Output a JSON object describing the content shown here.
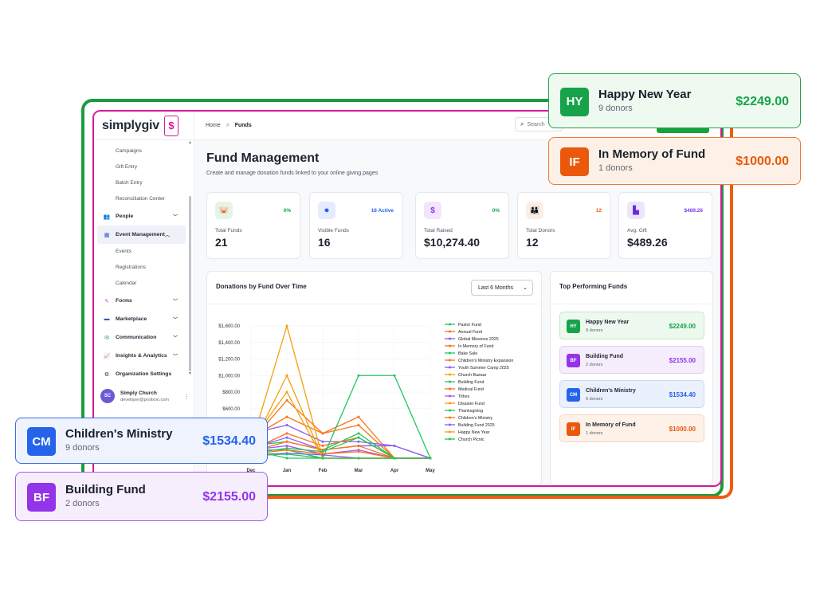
{
  "app": {
    "logo_text": "simplygiv",
    "logo_glyph": "$",
    "breadcrumb": {
      "home": "Home",
      "separator": ">",
      "current": "Funds"
    },
    "search_placeholder": "Search"
  },
  "sidebar": {
    "items": [
      {
        "label": "Campaigns",
        "kind": "sub"
      },
      {
        "label": "Gift Entry",
        "kind": "sub"
      },
      {
        "label": "Batch Entry",
        "kind": "sub"
      },
      {
        "label": "Reconciliation Center",
        "kind": "sub"
      },
      {
        "label": "People",
        "kind": "item",
        "icon": "people-icon",
        "chevron": "down"
      },
      {
        "label": "Event Management",
        "kind": "item",
        "icon": "calendar-icon",
        "chevron": "up",
        "active": true
      },
      {
        "label": "Events",
        "kind": "sub"
      },
      {
        "label": "Registrations",
        "kind": "sub"
      },
      {
        "label": "Calendar",
        "kind": "sub"
      },
      {
        "label": "Forms",
        "kind": "item",
        "icon": "forms-icon",
        "chevron": "down"
      },
      {
        "label": "Marketplace",
        "kind": "item",
        "icon": "store-icon",
        "chevron": "down"
      },
      {
        "label": "Communication",
        "kind": "item",
        "icon": "mail-icon",
        "chevron": "down"
      },
      {
        "label": "Insights & Analytics",
        "kind": "item",
        "icon": "analytics-icon",
        "chevron": "down"
      },
      {
        "label": "Organization Settings",
        "kind": "item",
        "icon": "gear-icon"
      }
    ],
    "user": {
      "initials": "SC",
      "name": "Simply Church",
      "email": "developer@prolixon.com"
    }
  },
  "page": {
    "title": "Fund Management",
    "subtitle": "Create and manage donation funds linked to your online giving pages"
  },
  "stats": [
    {
      "label": "Total Funds",
      "value": "21",
      "badge": "0%",
      "badge_color": "#16a34a",
      "icon": "piggy-bank-icon",
      "icon_bg": "#e3f5e8",
      "icon_color": "#16a34a"
    },
    {
      "label": "Visible Funds",
      "value": "16",
      "badge": "16 Active",
      "badge_color": "#2563eb",
      "icon": "toggle-icon",
      "icon_bg": "#e4ecfd",
      "icon_color": "#2563eb"
    },
    {
      "label": "Total Raised",
      "value": "$10,274.40",
      "badge": "0%",
      "badge_color": "#16a34a",
      "icon": "dollar-icon",
      "icon_bg": "#f1e6fb",
      "icon_color": "#9333ea"
    },
    {
      "label": "Total Donors",
      "value": "12",
      "badge": "12",
      "badge_color": "#ea580c",
      "icon": "donors-icon",
      "icon_bg": "#fdeee3",
      "icon_color": "#ea580c"
    },
    {
      "label": "Avg. Gift",
      "value": "$489.26",
      "badge": "$489.26",
      "badge_color": "#7c3aed",
      "icon": "chart-icon",
      "icon_bg": "#eae6fb",
      "icon_color": "#6d28d9"
    }
  ],
  "donations_card": {
    "title": "Donations by Fund Over Time",
    "range": "Last 6 Months"
  },
  "chart_data": {
    "type": "line",
    "title": "Donations by Fund Over Time",
    "x": [
      "Dec",
      "Jan",
      "Feb",
      "Mar",
      "Apr",
      "May"
    ],
    "y_ticks": [
      "$1,600.00",
      "$1,400.00",
      "$1,200.00",
      "$1,000.00",
      "$800.00",
      "$600.00"
    ],
    "ylim": [
      0,
      1600
    ],
    "grid": true,
    "legend_position": "right",
    "series": [
      {
        "name": "Pastor Fund",
        "color": "#22c55e",
        "values": [
          100,
          0,
          0,
          0,
          0,
          0
        ]
      },
      {
        "name": "Annual Fund",
        "color": "#f97316",
        "values": [
          200,
          700,
          300,
          500,
          0,
          0
        ]
      },
      {
        "name": "Global Missions 2025",
        "color": "#8b5cf6",
        "values": [
          300,
          400,
          200,
          200,
          150,
          0
        ]
      },
      {
        "name": "In Memory of Fund",
        "color": "#f97316",
        "values": [
          250,
          500,
          300,
          400,
          0,
          0
        ]
      },
      {
        "name": "Bake Sale",
        "color": "#22c55e",
        "values": [
          150,
          200,
          100,
          300,
          0,
          0
        ]
      },
      {
        "name": "Children's Ministry Expansion",
        "color": "#f97316",
        "values": [
          100,
          300,
          150,
          250,
          0,
          0
        ]
      },
      {
        "name": "Youth Summer Camp 2025",
        "color": "#8b5cf6",
        "values": [
          120,
          250,
          100,
          150,
          150,
          0
        ]
      },
      {
        "name": "Church Bazaar",
        "color": "#f59e0b",
        "values": [
          150,
          1600,
          0,
          0,
          0,
          0
        ]
      },
      {
        "name": "Building Fund",
        "color": "#22c55e",
        "values": [
          100,
          100,
          0,
          1000,
          1000,
          0
        ]
      },
      {
        "name": "Medical Fund",
        "color": "#f97316",
        "values": [
          80,
          200,
          100,
          150,
          0,
          0
        ]
      },
      {
        "name": "Tithes",
        "color": "#a855f7",
        "values": [
          100,
          150,
          50,
          100,
          0,
          0
        ]
      },
      {
        "name": "Disaster Fund",
        "color": "#f59e0b",
        "values": [
          120,
          1000,
          0,
          0,
          0,
          0
        ]
      },
      {
        "name": "Thanksgiving",
        "color": "#22c55e",
        "values": [
          60,
          120,
          80,
          250,
          0,
          0
        ]
      },
      {
        "name": "Children's Ministry",
        "color": "#f97316",
        "values": [
          50,
          100,
          50,
          80,
          0,
          0
        ]
      },
      {
        "name": "Building Fund 2025",
        "color": "#8b5cf6",
        "values": [
          40,
          60,
          40,
          0,
          0,
          0
        ]
      },
      {
        "name": "Happy New Year",
        "color": "#f59e0b",
        "values": [
          200,
          800,
          0,
          0,
          0,
          0
        ]
      },
      {
        "name": "Church Picnic",
        "color": "#22c55e",
        "values": [
          30,
          50,
          0,
          0,
          0,
          0
        ]
      }
    ]
  },
  "top_funds": {
    "title": "Top Performing Funds",
    "items": [
      {
        "initials": "HY",
        "name": "Happy New Year",
        "donors": "9 donors",
        "amount": "$2249.00",
        "accent": "#16a34a",
        "bg": "#edf9ef",
        "border": "#bfe8c9"
      },
      {
        "initials": "BF",
        "name": "Building Fund",
        "donors": "2 donors",
        "amount": "$2155.00",
        "accent": "#9333ea",
        "bg": "#f5edfc",
        "border": "#e2cdf6"
      },
      {
        "initials": "CM",
        "name": "Children's Ministry",
        "donors": "9 donors",
        "amount": "$1534.40",
        "accent": "#2563eb",
        "bg": "#eaf1fd",
        "border": "#c8d9f8"
      },
      {
        "initials": "IF",
        "name": "In Memory of Fund",
        "donors": "1 donors",
        "amount": "$1000.00",
        "accent": "#ea580c",
        "bg": "#fdf1e8",
        "border": "#f6d6bf"
      }
    ]
  },
  "callouts": [
    {
      "initials": "HY",
      "name": "Happy New Year",
      "donors": "9 donors",
      "amount": "$2249.00",
      "accent": "#16a34a",
      "bg": "#eef9f0",
      "border": "#22a447"
    },
    {
      "initials": "IF",
      "name": "In Memory of Fund",
      "donors": "1 donors",
      "amount": "$1000.00",
      "accent": "#ea580c",
      "bg": "#fdf1e7",
      "border": "#ee7a34"
    },
    {
      "initials": "CM",
      "name": "Children's Ministry",
      "donors": "9 donors",
      "amount": "$1534.40",
      "accent": "#2563eb",
      "bg": "#eef3fd",
      "border": "#3c6be4"
    },
    {
      "initials": "BF",
      "name": "Building Fund",
      "donors": "2 donors",
      "amount": "$2155.00",
      "accent": "#9333ea",
      "bg": "#f6eefd",
      "border": "#a45ae8"
    }
  ]
}
